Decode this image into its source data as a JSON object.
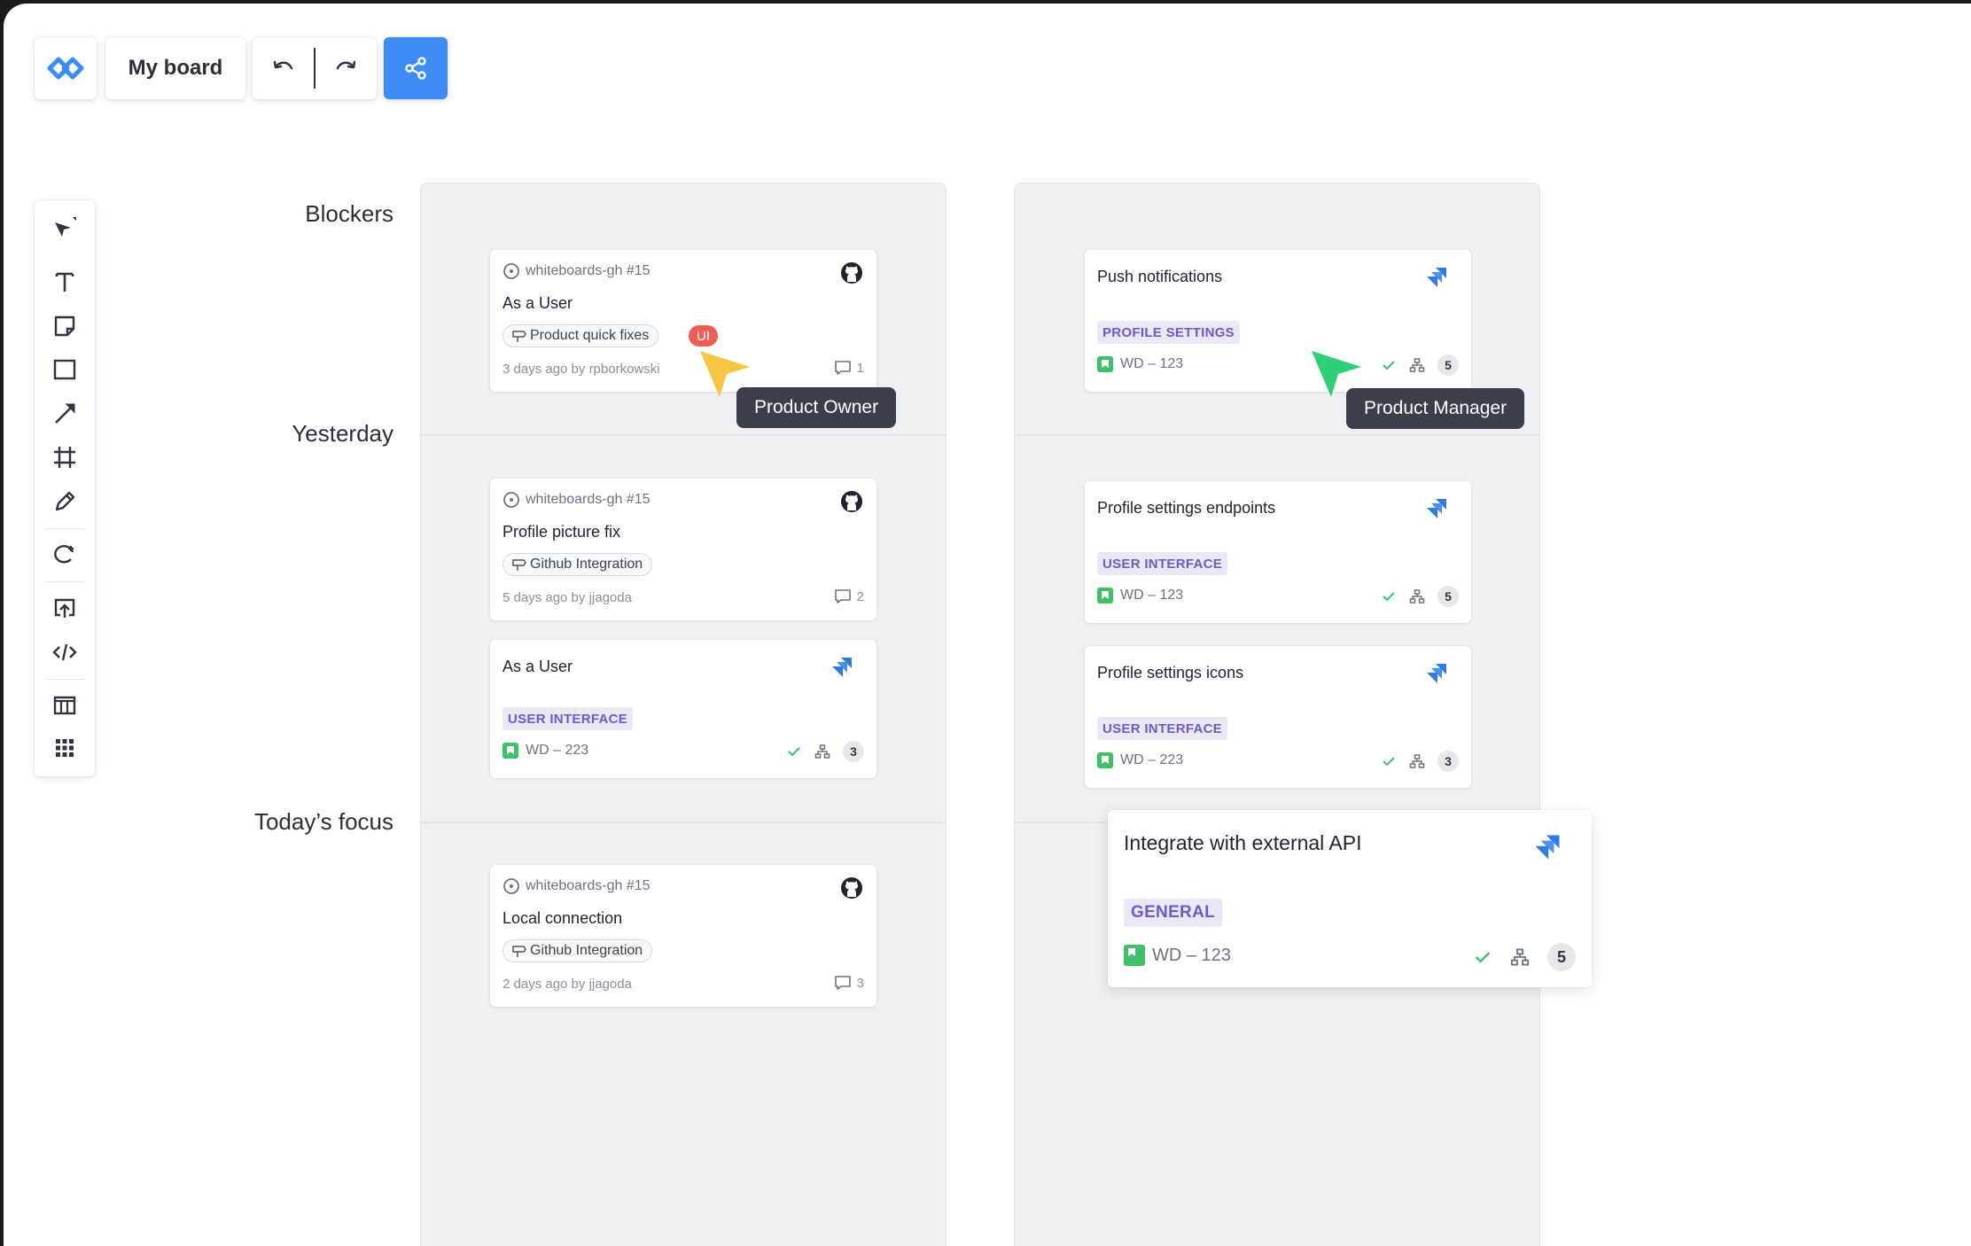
{
  "header": {
    "board_title": "My board"
  },
  "colors": {
    "accent": "#3d8cf5",
    "product_owner_cursor": "#f6c544",
    "product_manager_cursor": "#2fcf7a",
    "label_purple": "#6f5ac9",
    "status_green": "#3fbf68",
    "ui_badge": "#ef5d57"
  },
  "tools": [
    "select-tool",
    "text-tool",
    "sticky-note-tool",
    "rectangle-tool",
    "line-tool",
    "frame-tool",
    "pen-tool",
    "lasso-tool",
    "upload-tool",
    "embed-code-tool",
    "table-tool",
    "apps-tool"
  ],
  "rows": {
    "blockers": "Blockers",
    "yesterday": "Yesterday",
    "today": "Today’s  focus"
  },
  "col1": {
    "card1": {
      "meta": "whiteboards-gh #15",
      "title": "As a User",
      "tag": "Product quick fixes",
      "badge": "UI",
      "footer": "3 days ago by rpborkowski",
      "comments": "1"
    },
    "card2": {
      "meta": "whiteboards-gh #15",
      "title": "Profile picture fix",
      "tag": "Github Integration",
      "footer": "5 days ago by jjagoda",
      "comments": "2"
    },
    "card3": {
      "title": "As a User",
      "label": "USER INTERFACE",
      "key": "WD – 223",
      "count": "3"
    },
    "card4": {
      "meta": "whiteboards-gh #15",
      "title": "Local connection",
      "tag": "Github Integration",
      "footer": "2 days ago by jjagoda",
      "comments": "3"
    }
  },
  "col2": {
    "card1": {
      "title": "Push notifications",
      "label": "PROFILE SETTINGS",
      "key": "WD – 123",
      "count": "5"
    },
    "card2": {
      "title": "Profile settings endpoints",
      "label": "USER INTERFACE",
      "key": "WD – 123",
      "count": "5"
    },
    "card3": {
      "title": "Profile settings icons",
      "label": "USER INTERFACE",
      "key": "WD – 223",
      "count": "3"
    },
    "card4": {
      "title": "Integrate with external API",
      "label": "GENERAL",
      "key": "WD – 123",
      "count": "5"
    }
  },
  "cursors": {
    "owner": "Product Owner",
    "manager": "Product Manager"
  }
}
